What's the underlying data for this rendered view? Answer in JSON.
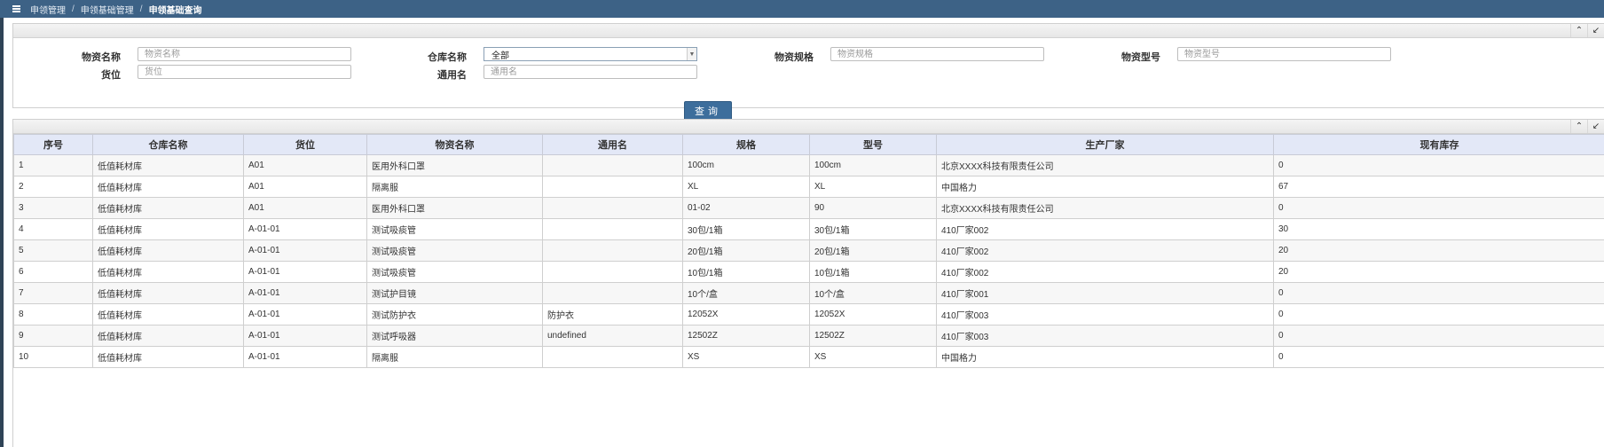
{
  "breadcrumb": [
    "申领管理",
    "申领基础管理",
    "申领基础查询"
  ],
  "search": {
    "fields": {
      "wuzi_mingcheng": {
        "label": "物资名称",
        "placeholder": "物资名称",
        "value": ""
      },
      "cangku_mingcheng": {
        "label": "仓库名称",
        "value": "全部"
      },
      "wuzi_guige": {
        "label": "物资规格",
        "placeholder": "物资规格",
        "value": ""
      },
      "wuzi_xinghao": {
        "label": "物资型号",
        "placeholder": "物资型号",
        "value": ""
      },
      "huowei": {
        "label": "货位",
        "placeholder": "货位",
        "value": ""
      },
      "tongyongming": {
        "label": "通用名",
        "placeholder": "通用名",
        "value": ""
      }
    },
    "query_button": "查询"
  },
  "table": {
    "columns": [
      "序号",
      "仓库名称",
      "货位",
      "物资名称",
      "通用名",
      "规格",
      "型号",
      "生产厂家",
      "现有库存"
    ],
    "rows": [
      [
        "1",
        "低值耗材库",
        "A01",
        "医用外科口罩",
        "",
        "100cm",
        "100cm",
        "北京XXXX科技有限责任公司",
        "0"
      ],
      [
        "2",
        "低值耗材库",
        "A01",
        "隔离服",
        "",
        "XL",
        "XL",
        "中国格力",
        "67"
      ],
      [
        "3",
        "低值耗材库",
        "A01",
        "医用外科口罩",
        "",
        "01-02",
        "90",
        "北京XXXX科技有限责任公司",
        "0"
      ],
      [
        "4",
        "低值耗材库",
        "A-01-01",
        "测试吸痰管",
        "",
        "30包/1箱",
        "30包/1箱",
        "410厂家002",
        "30"
      ],
      [
        "5",
        "低值耗材库",
        "A-01-01",
        "测试吸痰管",
        "",
        "20包/1箱",
        "20包/1箱",
        "410厂家002",
        "20"
      ],
      [
        "6",
        "低值耗材库",
        "A-01-01",
        "测试吸痰管",
        "",
        "10包/1箱",
        "10包/1箱",
        "410厂家002",
        "20"
      ],
      [
        "7",
        "低值耗材库",
        "A-01-01",
        "测试护目镜",
        "",
        "10个/盒",
        "10个/盒",
        "410厂家001",
        "0"
      ],
      [
        "8",
        "低值耗材库",
        "A-01-01",
        "测试防护衣",
        "防护衣",
        "12052X",
        "12052X",
        "410厂家003",
        "0"
      ],
      [
        "9",
        "低值耗材库",
        "A-01-01",
        "测试呼吸器",
        "undefined",
        "12502Z",
        "12502Z",
        "410厂家003",
        "0"
      ],
      [
        "10",
        "低值耗材库",
        "A-01-01",
        "隔离服",
        "",
        "XS",
        "XS",
        "中国格力",
        "0"
      ]
    ]
  },
  "icons": {
    "collapse": "chevron-up-icon",
    "expand": "expand-icon",
    "menu": "menu-icon"
  }
}
